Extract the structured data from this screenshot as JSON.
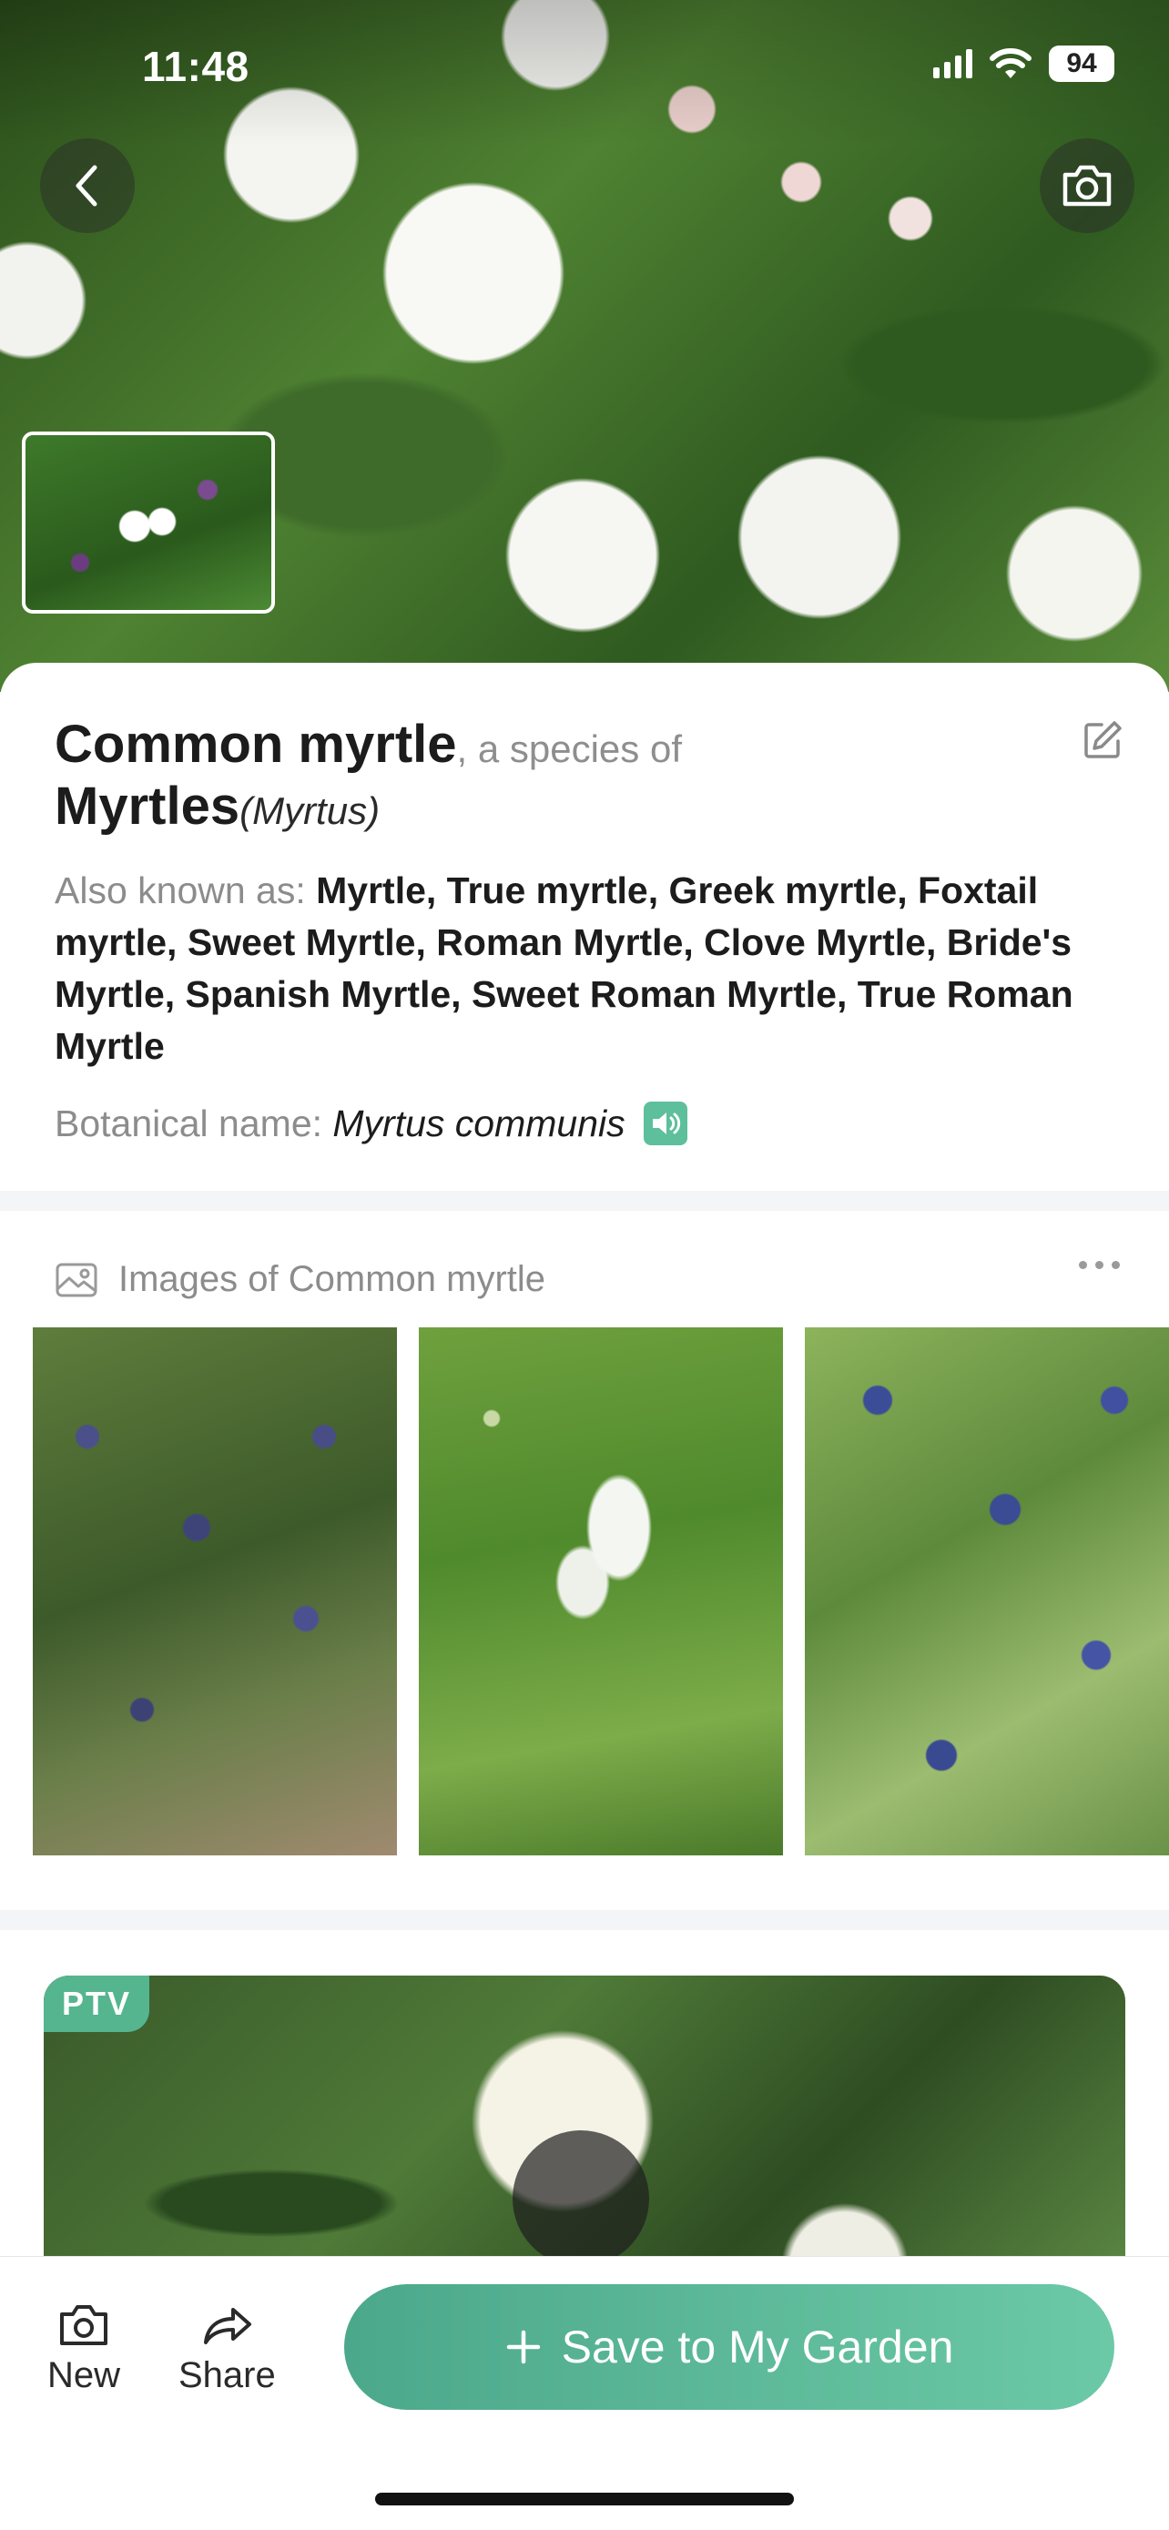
{
  "status_bar": {
    "time": "11:48",
    "battery": "94"
  },
  "hero": {
    "back_icon": "chevron-left-icon",
    "camera_icon": "camera-icon"
  },
  "plant": {
    "common_name": "Common myrtle",
    "species_of_text": ", a species of",
    "genus_common": "Myrtles",
    "genus_latin": "(Myrtus)",
    "also_known_label": "Also known as: ",
    "also_known_names": "Myrtle, True myrtle, Greek myrtle, Foxtail myrtle, Sweet Myrtle, Roman Myrtle, Clove Myrtle, Bride's Myrtle, Spanish Myrtle, Sweet Roman Myrtle, True Roman Myrtle",
    "botanical_label": "Botanical name: ",
    "botanical_name": "Myrtus communis"
  },
  "images_section": {
    "title": "Images of Common myrtle",
    "icon": "image-gallery-icon",
    "more_icon": "more-dots-icon"
  },
  "video": {
    "badge": "PTV"
  },
  "bottom_bar": {
    "new_label": "New",
    "share_label": "Share",
    "save_label": "Save to My Garden"
  },
  "colors": {
    "accent": "#5dbf9c",
    "save_gradient_start": "#4ca88a",
    "save_gradient_end": "#6cc9a7",
    "muted_text": "#8c8c8c"
  }
}
